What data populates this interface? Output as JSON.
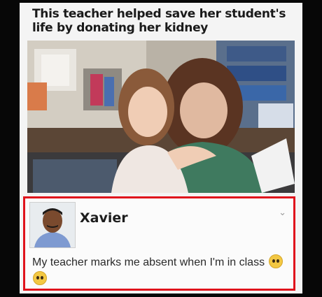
{
  "post": {
    "headline": "This teacher helped save her student's life by donating her kidney",
    "photo": {
      "subject": "photo of a teacher hugging a young student in a classroom",
      "colors": {
        "wall": "#cfcac0",
        "desk": "#5b4636",
        "shirt": "#3f7a5f",
        "girl_hair": "#8a5a3a",
        "teacher_hair": "#5a3422"
      }
    }
  },
  "comment": {
    "author": "Xavier",
    "text": "My teacher marks me absent when I'm in class",
    "emoji": [
      "pleading-face",
      "pleading-face"
    ],
    "highlight_color": "#e0131c"
  }
}
